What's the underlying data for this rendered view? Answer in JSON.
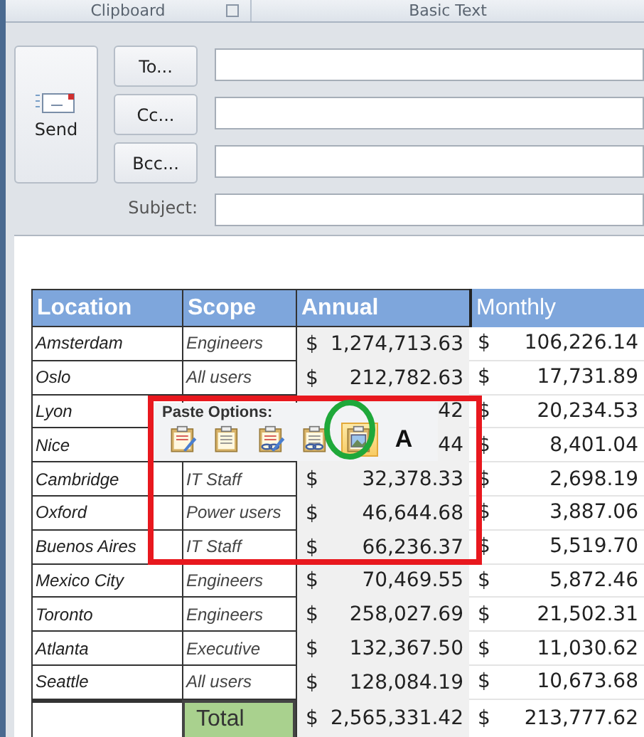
{
  "ribbon": {
    "groups": [
      {
        "label": "Clipboard",
        "launcher": true
      },
      {
        "label": "Basic Text",
        "launcher": false
      }
    ]
  },
  "compose": {
    "send": "Send",
    "address_buttons": [
      {
        "label": "To..."
      },
      {
        "label": "Cc..."
      },
      {
        "label": "Bcc..."
      }
    ],
    "subject_label": "Subject:"
  },
  "table": {
    "columns": [
      "Location",
      "Scope",
      "Annual",
      "Monthly"
    ],
    "rows": [
      {
        "location": "Amsterdam",
        "scope": "Engineers",
        "annual_symbol": "$",
        "annual": "1,274,713.63",
        "monthly_symbol": "$",
        "monthly": "106,226.14"
      },
      {
        "location": "Oslo",
        "scope": "All users",
        "annual_symbol": "$",
        "annual": "212,782.63",
        "monthly_symbol": "$",
        "monthly": "17,731.89"
      },
      {
        "location": "Lyon",
        "annual": "42",
        "monthly_symbol": "$",
        "monthly": "20,234.53"
      },
      {
        "location": "Nice",
        "annual": "44",
        "monthly_symbol": "$",
        "monthly": "8,401.04"
      },
      {
        "location": "Cambridge",
        "scope": "IT Staff",
        "annual_symbol": "$",
        "annual": "32,378.33",
        "monthly_symbol": "$",
        "monthly": "2,698.19"
      },
      {
        "location": "Oxford",
        "scope": "Power users",
        "annual_symbol": "$",
        "annual": "46,644.68",
        "monthly_symbol": "$",
        "monthly": "3,887.06"
      },
      {
        "location": "Buenos Aires",
        "scope": "IT Staff",
        "annual_symbol": "$",
        "annual": "66,236.37",
        "monthly_symbol": "$",
        "monthly": "5,519.70"
      },
      {
        "location": "Mexico City",
        "scope": "Engineers",
        "annual_symbol": "$",
        "annual": "70,469.55",
        "monthly_symbol": "$",
        "monthly": "5,872.46"
      },
      {
        "location": "Toronto",
        "scope": "Engineers",
        "annual_symbol": "$",
        "annual": "258,027.69",
        "monthly_symbol": "$",
        "monthly": "21,502.31"
      },
      {
        "location": "Atlanta",
        "scope": "Executive",
        "annual_symbol": "$",
        "annual": "132,367.50",
        "monthly_symbol": "$",
        "monthly": "11,030.62"
      },
      {
        "location": "Seattle",
        "scope": "All users",
        "annual_symbol": "$",
        "annual": "128,084.19",
        "monthly_symbol": "$",
        "monthly": "10,673.68"
      }
    ],
    "total": {
      "label": "Total",
      "annual_symbol": "$",
      "annual": "2,565,331.42",
      "monthly_symbol": "$",
      "monthly": "213,777.62"
    }
  },
  "paste_options": {
    "title": "Paste Options:",
    "options": [
      {
        "kind": "brush",
        "selected": false
      },
      {
        "kind": "plain",
        "selected": false
      },
      {
        "kind": "link-brush",
        "selected": false
      },
      {
        "kind": "link",
        "selected": false
      },
      {
        "kind": "picture",
        "selected": true
      },
      {
        "kind": "text",
        "label": "A",
        "selected": false
      }
    ]
  }
}
